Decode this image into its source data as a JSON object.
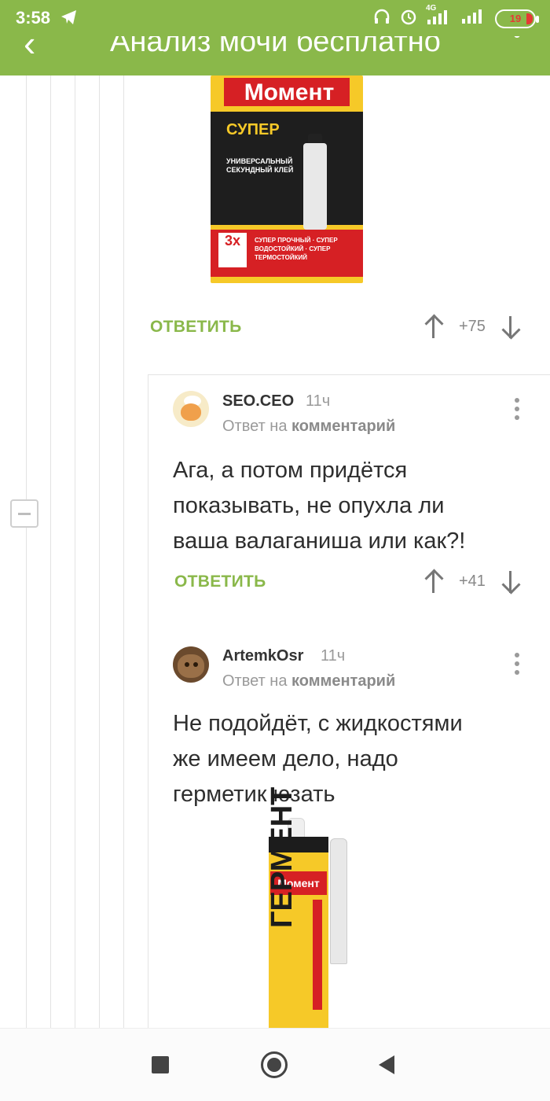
{
  "status_bar": {
    "time": "3:58",
    "battery": "19",
    "network": "4G"
  },
  "header": {
    "title": "Анализ мочи бесплатно"
  },
  "comments": [
    {
      "reply_label": "ОТВЕТИТЬ",
      "score": "+75"
    },
    {
      "username": "SEO.CEO",
      "time": "11ч",
      "reply_prefix": "Ответ на",
      "reply_target": "комментарий",
      "text_lines": [
        "Ага, а потом придётся",
        "показывать, не опухла ли",
        "ваша валаганиша или как?!"
      ],
      "reply_label": "ОТВЕТИТЬ",
      "score": "+41"
    },
    {
      "username": "ArtemkOsr",
      "time": "11ч",
      "reply_prefix": "Ответ на",
      "reply_target": "комментарий",
      "text_lines": [
        "Не подойдёт, с жидкостями",
        "же имеем дело, надо",
        "герметик юзать"
      ]
    }
  ],
  "images": {
    "glue": {
      "brand": "Момент",
      "product": "СУПЕР",
      "description": "УНИВЕРСАЛЬНЫЙ СЕКУНДНЫЙ КЛЕЙ",
      "badge": "3x",
      "features": "СУПЕР ПРОЧНЫЙ · СУПЕР ВОДОСТОЙКИЙ · СУПЕР ТЕРМОСТОЙКИЙ"
    },
    "sealant": {
      "brand": "Момент",
      "product": "ГЕРМЕНТ"
    }
  },
  "icons": {
    "back": "arrow-left-icon",
    "menu": "more-vertical-icon",
    "upvote": "arrow-up-icon",
    "downvote": "arrow-down-icon",
    "telegram": "telegram-icon"
  },
  "colors": {
    "accent": "#8ab84a",
    "header_bg": "#8ab84a"
  }
}
